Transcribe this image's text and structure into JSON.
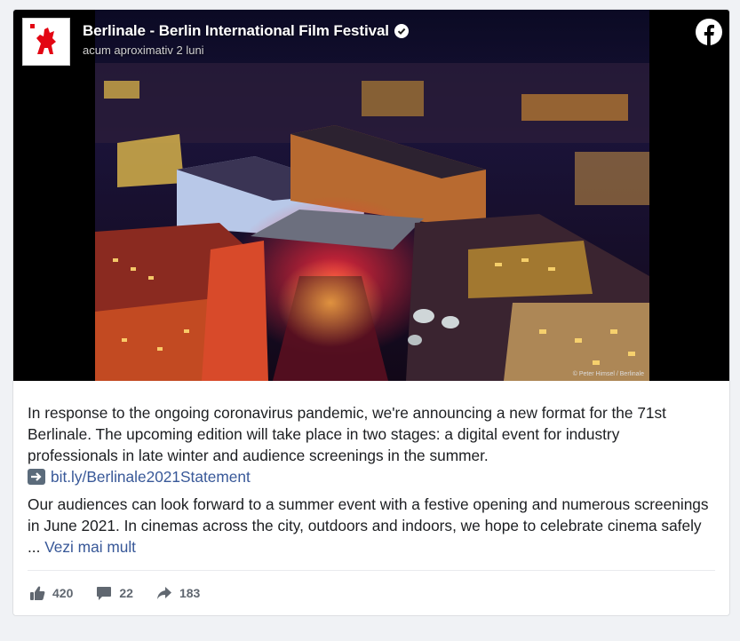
{
  "post": {
    "page_name": "Berlinale - Berlin International Film Festival",
    "timestamp": "acum aproximativ 2 luni",
    "photo_credit": "© Peter Himsel / Berlinale",
    "paragraph1": "In response to the ongoing coronavirus pandemic, we're announcing a new format for the 71st Berlinale. The upcoming edition will take place in two stages: a digital event for industry professionals in late winter and audience screenings in the summer.",
    "link_text": "bit.ly/Berlinale2021Statement",
    "paragraph2": "Our audiences can look forward to a summer event with a festive opening and numerous screenings in June 2021. In cinemas across the city, outdoors and indoors, we hope to celebrate cinema safely ...",
    "see_more": "Vezi mai mult"
  },
  "stats": {
    "likes": "420",
    "comments": "22",
    "shares": "183"
  },
  "icons": {
    "logo": "berlinale-bear-logo",
    "verified": "verified-badge-icon",
    "facebook": "facebook-icon",
    "arrow": "right-arrow-emoji-icon",
    "like": "thumbs-up-icon",
    "comment": "comment-icon",
    "share": "share-arrow-icon"
  },
  "colors": {
    "link": "#385898",
    "text": "#1c1e21",
    "muted": "#606770",
    "berlinale_red": "#e30613"
  }
}
